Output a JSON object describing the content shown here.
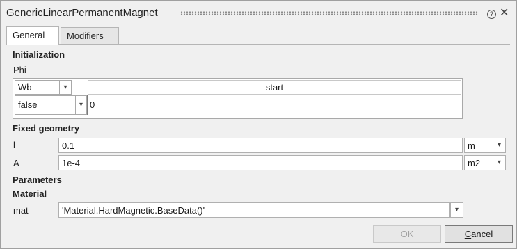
{
  "window": {
    "title": "GenericLinearPermanentMagnet"
  },
  "tabs": [
    {
      "label": "General",
      "active": true
    },
    {
      "label": "Modifiers",
      "active": false
    }
  ],
  "sections": {
    "initialization": "Initialization",
    "fixed_geometry": "Fixed geometry",
    "parameters": "Parameters",
    "material": "Material"
  },
  "phi": {
    "label": "Phi",
    "unit": "Wb",
    "column_header": "start",
    "fixed": "false",
    "start_value": "0"
  },
  "params": {
    "l": {
      "label": "l",
      "value": "0.1",
      "unit": "m"
    },
    "A": {
      "label": "A",
      "value": "1e-4",
      "unit": "m2"
    },
    "mat": {
      "label": "mat",
      "value": "'Material.HardMagnetic.BaseData()'"
    }
  },
  "buttons": {
    "ok": "OK",
    "cancel_first": "C",
    "cancel_rest": "ancel"
  }
}
